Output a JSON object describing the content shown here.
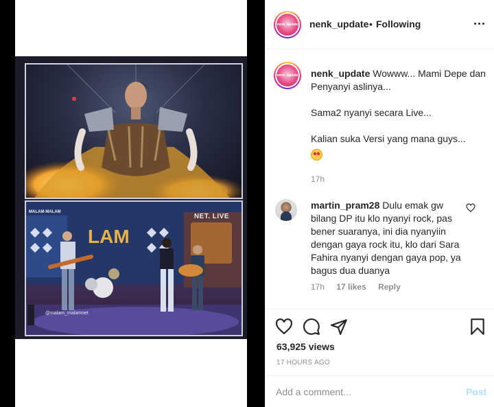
{
  "post": {
    "username": "nenk_update",
    "follow_separator": "•",
    "follow_status": "Following",
    "avatar_label": "nenk_update"
  },
  "caption": {
    "username": "nenk_update",
    "line1": "Wowww... Mami Depe dan Penyanyi aslinya...",
    "line2": "Sama2 nyanyi secara Live...",
    "line3": "Kalian suka Versi yang mana guys...",
    "time": "17h"
  },
  "comment": {
    "username": "martin_pram28",
    "text": "Dulu emak gw bilang DP itu klo nyanyi rock, pas bener suaranya, ini dia nyanyiin dengan gaya rock itu, klo dari Sara Fahira nyanyi dengan gaya pop, ya bagus dua duanya",
    "time": "17h",
    "likes": "17 likes",
    "reply": "Reply"
  },
  "video": {
    "channel_tag": "NET. LIVE",
    "show_tag": "MALAM-MALAM",
    "handle": "@malam_malamnet"
  },
  "stats": {
    "views": "63,925 views",
    "time_ago": "17 HOURS AGO"
  },
  "add_comment": {
    "placeholder": "Add a comment...",
    "post_label": "Post"
  },
  "colors": {
    "text": "#262626",
    "muted": "#8e8e8e",
    "post_disabled": "#b2dffc",
    "border": "#efefef"
  },
  "icons": [
    "more-icon",
    "heart-icon",
    "comment-icon",
    "share-icon",
    "bookmark-icon",
    "like-comment-icon"
  ]
}
